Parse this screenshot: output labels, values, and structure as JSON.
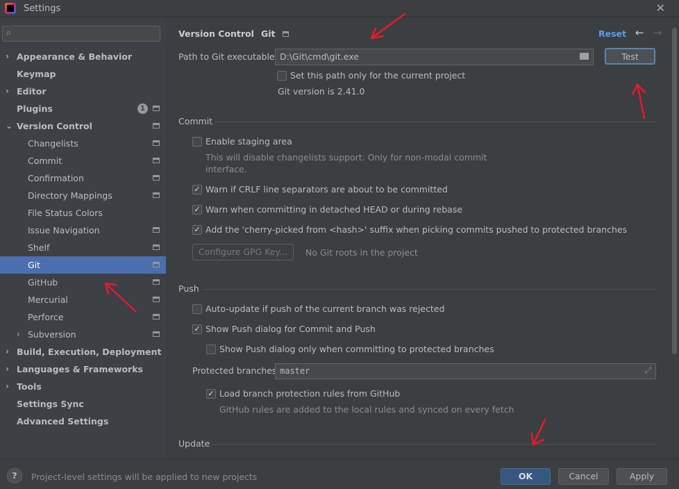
{
  "window": {
    "title": "Settings",
    "close": "✕"
  },
  "sidebar": {
    "search_icon": "⌕",
    "items": [
      {
        "label": "Appearance & Behavior",
        "bold": true,
        "chev": "›",
        "level": 0
      },
      {
        "label": "Keymap",
        "bold": true,
        "level": 0
      },
      {
        "label": "Editor",
        "bold": true,
        "chev": "›",
        "level": 0
      },
      {
        "label": "Plugins",
        "bold": true,
        "level": 0,
        "badge": "1",
        "pi": true
      },
      {
        "label": "Version Control",
        "bold": true,
        "chev": "⌄",
        "level": 0,
        "pi": true
      },
      {
        "label": "Changelists",
        "level": 1,
        "pi": true
      },
      {
        "label": "Commit",
        "level": 1,
        "pi": true
      },
      {
        "label": "Confirmation",
        "level": 1,
        "pi": true
      },
      {
        "label": "Directory Mappings",
        "level": 1,
        "pi": true
      },
      {
        "label": "File Status Colors",
        "level": 1
      },
      {
        "label": "Issue Navigation",
        "level": 1,
        "pi": true
      },
      {
        "label": "Shelf",
        "level": 1,
        "pi": true
      },
      {
        "label": "Git",
        "level": 1,
        "pi": true,
        "selected": true
      },
      {
        "label": "GitHub",
        "level": 1,
        "pi": true
      },
      {
        "label": "Mercurial",
        "level": 1,
        "pi": true
      },
      {
        "label": "Perforce",
        "level": 1,
        "pi": true
      },
      {
        "label": "Subversion",
        "level": 1,
        "chev": "›",
        "pi": true
      },
      {
        "label": "Build, Execution, Deployment",
        "bold": true,
        "chev": "›",
        "level": 0
      },
      {
        "label": "Languages & Frameworks",
        "bold": true,
        "chev": "›",
        "level": 0
      },
      {
        "label": "Tools",
        "bold": true,
        "chev": "›",
        "level": 0
      },
      {
        "label": "Settings Sync",
        "bold": true,
        "level": 0
      },
      {
        "label": "Advanced Settings",
        "bold": true,
        "level": 0
      }
    ]
  },
  "header": {
    "crumb1": "Version Control",
    "sep": "›",
    "crumb2": "Git",
    "reset": "Reset",
    "back": "←",
    "forward": "→"
  },
  "git": {
    "path_label": "Path to Git executable:",
    "path_value": "D:\\Git\\cmd\\git.exe",
    "test": "Test",
    "this_project": "Set this path only for the current project",
    "version": "Git version is 2.41.0"
  },
  "commit": {
    "title": "Commit",
    "staging": "Enable staging area",
    "staging_hint1": "This will disable changelists support. Only for non-modal commit",
    "staging_hint2": "interface.",
    "crlf": "Warn if CRLF line separators are about to be committed",
    "detached": "Warn when committing in detached HEAD or during rebase",
    "cherry": "Add the 'cherry-picked from <hash>' suffix when picking commits pushed to protected branches",
    "gpg": "Configure GPG Key...",
    "no_roots": "No Git roots in the project"
  },
  "push": {
    "title": "Push",
    "auto_update": "Auto-update if push of the current branch was rejected",
    "show_dialog": "Show Push dialog for Commit and Push",
    "only_protected": "Show Push dialog only when committing to protected branches",
    "protected_label": "Protected branches:",
    "protected_value": "master",
    "load_rules": "Load branch protection rules from GitHub",
    "rules_hint": "GitHub rules are added to the local rules and synced on every fetch"
  },
  "update": {
    "title": "Update"
  },
  "footer": {
    "help": "?",
    "note": "Project-level settings will be applied to new projects",
    "ok": "OK",
    "cancel": "Cancel",
    "apply": "Apply"
  },
  "colors": {
    "accent": "#4b6eaf",
    "ok_button": "#365880",
    "annotation": "#e8192c"
  }
}
